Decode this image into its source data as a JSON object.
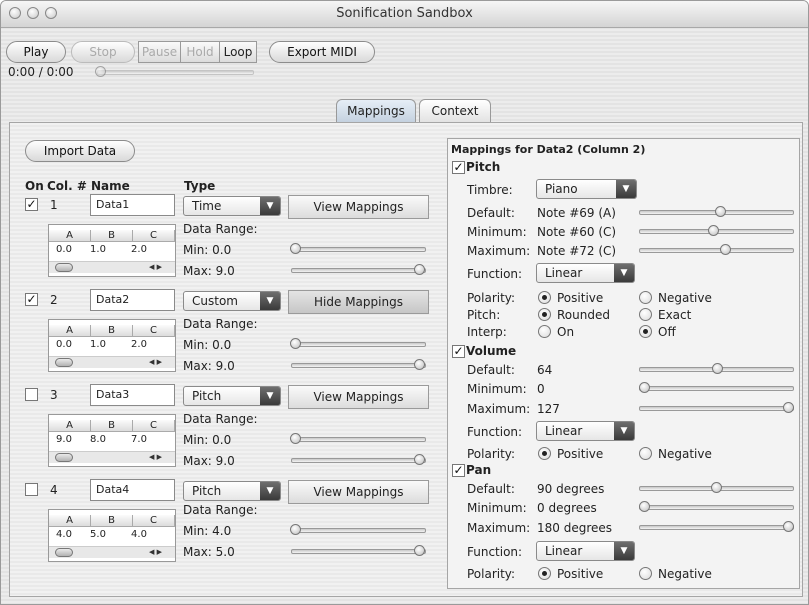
{
  "window": {
    "title": "Sonification Sandbox"
  },
  "toolbar": {
    "play": "Play",
    "stop": "Stop",
    "pause": "Pause",
    "hold": "Hold",
    "loop": "Loop",
    "export_midi": "Export MIDI",
    "time": "0:00 / 0:00"
  },
  "tabs": [
    {
      "label": "Mappings",
      "active": true
    },
    {
      "label": "Context",
      "active": false
    }
  ],
  "left": {
    "import_button": "Import Data",
    "headers": {
      "on": "On",
      "col": "Col. #",
      "name": "Name",
      "type": "Type"
    },
    "data_range_label": "Data Range:",
    "rows": [
      {
        "checked": true,
        "col": "1",
        "name": "Data1",
        "type": "Time",
        "button": "View Mappings",
        "cols": [
          "A",
          "B",
          "C"
        ],
        "values": [
          "0.0",
          "1.0",
          "2.0"
        ],
        "min": "Min: 0.0",
        "max": "Max: 9.0"
      },
      {
        "checked": true,
        "col": "2",
        "name": "Data2",
        "type": "Custom",
        "button": "Hide Mappings",
        "cols": [
          "A",
          "B",
          "C"
        ],
        "values": [
          "0.0",
          "1.0",
          "2.0"
        ],
        "min": "Min: 0.0",
        "max": "Max: 9.0"
      },
      {
        "checked": false,
        "col": "3",
        "name": "Data3",
        "type": "Pitch",
        "button": "View Mappings",
        "cols": [
          "A",
          "B",
          "C"
        ],
        "values": [
          "9.0",
          "8.0",
          "7.0"
        ],
        "min": "Min: 0.0",
        "max": "Max: 9.0"
      },
      {
        "checked": false,
        "col": "4",
        "name": "Data4",
        "type": "Pitch",
        "button": "View Mappings",
        "cols": [
          "A",
          "B",
          "C"
        ],
        "values": [
          "4.0",
          "5.0",
          "4.0"
        ],
        "min": "Min: 4.0",
        "max": "Max: 5.0"
      }
    ]
  },
  "right": {
    "heading": "Mappings for Data2 (Column 2)",
    "pitch": {
      "label": "Pitch",
      "checked": true,
      "timbre_label": "Timbre:",
      "timbre_value": "Piano",
      "default_label": "Default:",
      "default_value": "Note #69 (A)",
      "minimum_label": "Minimum:",
      "minimum_value": "Note #60 (C)",
      "maximum_label": "Maximum:",
      "maximum_value": "Note #72 (C)",
      "function_label": "Function:",
      "function_value": "Linear",
      "polarity_label": "Polarity:",
      "positive": "Positive",
      "negative": "Negative",
      "pitch_label": "Pitch:",
      "rounded": "Rounded",
      "exact": "Exact",
      "interp_label": "Interp:",
      "on": "On",
      "off": "Off"
    },
    "volume": {
      "label": "Volume",
      "checked": true,
      "default_label": "Default:",
      "default_value": "64",
      "minimum_label": "Minimum:",
      "minimum_value": "0",
      "maximum_label": "Maximum:",
      "maximum_value": "127",
      "function_label": "Function:",
      "function_value": "Linear",
      "polarity_label": "Polarity:",
      "positive": "Positive",
      "negative": "Negative"
    },
    "pan": {
      "label": "Pan",
      "checked": true,
      "default_label": "Default:",
      "default_value": "90 degrees",
      "minimum_label": "Minimum:",
      "minimum_value": "0 degrees",
      "maximum_label": "Maximum:",
      "maximum_value": "180 degrees",
      "function_label": "Function:",
      "function_value": "Linear",
      "polarity_label": "Polarity:",
      "positive": "Positive",
      "negative": "Negative"
    }
  }
}
